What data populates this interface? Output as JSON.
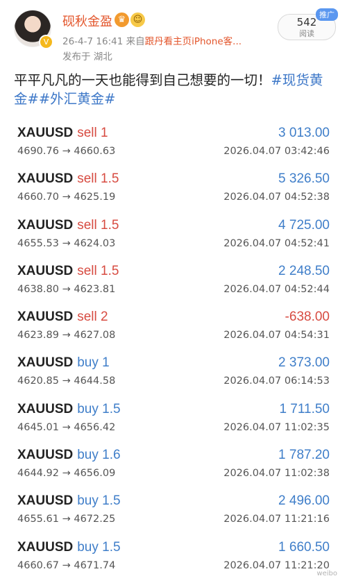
{
  "header": {
    "username": "砚秋金盈",
    "badge1_icon": "crown-medal-icon",
    "badge2_icon": "emoji-face-icon",
    "verified_icon": "verified-v-icon",
    "timestamp": "26-4-7 16:41",
    "via_prefix": "来自",
    "source": "跟丹看主页iPhone客...",
    "location": "发布于 湖北",
    "read_count": "542",
    "read_label": "阅读",
    "promo_tag": "推广"
  },
  "post": {
    "text": "平平凡凡的一天也能得到自己想要的一切！",
    "hashtags": "#现货黄金##外汇黄金#"
  },
  "trades": [
    {
      "symbol": "XAUUSD",
      "side": "sell",
      "lots": "1",
      "profit": "3 013.00",
      "open": "4690.76",
      "close": "4660.63",
      "time": "2026.04.07 03:42:46"
    },
    {
      "symbol": "XAUUSD",
      "side": "sell",
      "lots": "1.5",
      "profit": "5 326.50",
      "open": "4660.70",
      "close": "4625.19",
      "time": "2026.04.07 04:52:38"
    },
    {
      "symbol": "XAUUSD",
      "side": "sell",
      "lots": "1.5",
      "profit": "4 725.00",
      "open": "4655.53",
      "close": "4624.03",
      "time": "2026.04.07 04:52:41"
    },
    {
      "symbol": "XAUUSD",
      "side": "sell",
      "lots": "1.5",
      "profit": "2 248.50",
      "open": "4638.80",
      "close": "4623.81",
      "time": "2026.04.07 04:52:44"
    },
    {
      "symbol": "XAUUSD",
      "side": "sell",
      "lots": "2",
      "profit": "-638.00",
      "open": "4623.89",
      "close": "4627.08",
      "time": "2026.04.07 04:54:31"
    },
    {
      "symbol": "XAUUSD",
      "side": "buy",
      "lots": "1",
      "profit": "2 373.00",
      "open": "4620.85",
      "close": "4644.58",
      "time": "2026.04.07 06:14:53"
    },
    {
      "symbol": "XAUUSD",
      "side": "buy",
      "lots": "1.5",
      "profit": "1 711.50",
      "open": "4645.01",
      "close": "4656.42",
      "time": "2026.04.07 11:02:35"
    },
    {
      "symbol": "XAUUSD",
      "side": "buy",
      "lots": "1.6",
      "profit": "1 787.20",
      "open": "4644.92",
      "close": "4656.09",
      "time": "2026.04.07 11:02:38"
    },
    {
      "symbol": "XAUUSD",
      "side": "buy",
      "lots": "1.5",
      "profit": "2 496.00",
      "open": "4655.61",
      "close": "4672.25",
      "time": "2026.04.07 11:21:16"
    },
    {
      "symbol": "XAUUSD",
      "side": "buy",
      "lots": "1.5",
      "profit": "1 660.50",
      "open": "4660.67",
      "close": "4671.74",
      "time": "2026.04.07 11:21:20"
    }
  ],
  "arrow_glyph": "→",
  "colors": {
    "sell": "#d74b41",
    "buy": "#3f7ec9",
    "profit": "#3f7ec9",
    "loss": "#d74b41",
    "username": "#e3562c",
    "hashtag": "#3e78c8"
  }
}
